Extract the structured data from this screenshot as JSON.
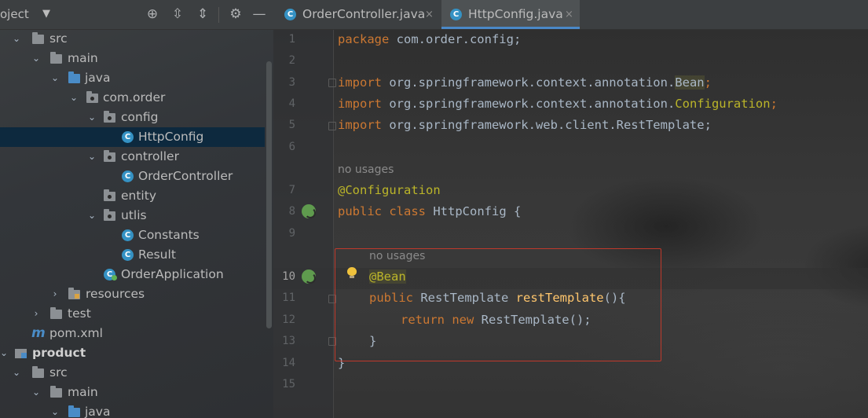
{
  "project_panel": {
    "title": "oject",
    "tree": [
      {
        "label": "src",
        "icon": "folder-icon"
      },
      {
        "label": "main",
        "icon": "folder-icon"
      },
      {
        "label": "java",
        "icon": "source-folder-icon"
      },
      {
        "label": "com.order",
        "icon": "package-icon"
      },
      {
        "label": "config",
        "icon": "package-icon"
      },
      {
        "label": "HttpConfig",
        "icon": "class-icon"
      },
      {
        "label": "controller",
        "icon": "package-icon"
      },
      {
        "label": "OrderController",
        "icon": "class-icon"
      },
      {
        "label": "entity",
        "icon": "package-icon"
      },
      {
        "label": "utlis",
        "icon": "package-icon"
      },
      {
        "label": "Constants",
        "icon": "class-icon"
      },
      {
        "label": "Result",
        "icon": "class-icon"
      },
      {
        "label": "OrderApplication",
        "icon": "spring-boot-class-icon"
      },
      {
        "label": "resources",
        "icon": "resources-folder-icon"
      },
      {
        "label": "test",
        "icon": "folder-icon"
      },
      {
        "label": "pom.xml",
        "icon": "maven-icon"
      },
      {
        "label": "product",
        "icon": "module-icon"
      },
      {
        "label": "src",
        "icon": "folder-icon"
      },
      {
        "label": "main",
        "icon": "folder-icon"
      },
      {
        "label": "java",
        "icon": "source-folder-icon"
      }
    ]
  },
  "tabs": [
    {
      "label": "OrderController.java",
      "close": "×"
    },
    {
      "label": "HttpConfig.java",
      "close": "×"
    }
  ],
  "class_glyph": "C",
  "maven_glyph": "m",
  "editor": {
    "line_numbers": [
      "1",
      "2",
      "3",
      "4",
      "5",
      "6",
      "7",
      "8",
      "9",
      "10",
      "11",
      "12",
      "13",
      "14",
      "15"
    ],
    "usages_hint": "no usages",
    "lines": {
      "l1_kw": "package",
      "l1_rest": " com.order.config;",
      "import_kw": "import",
      "l3_pkg": " org.springframework.context.annotation.",
      "l3_name": "Bean",
      "l4_pkg": " org.springframework.context.annotation.",
      "l4_name": "Configuration",
      "l5_rest": " org.springframework.web.client.RestTemplate;",
      "semicolon": ";",
      "l7_annotation": "@Configuration",
      "l8_kw1": "public",
      "l8_kw2": " class",
      "l8_rest": " HttpConfig {",
      "l10_annotation": "@Bean",
      "l11_kw": "public",
      "l11_type": " RestTemplate ",
      "l11_method": "restTemplate",
      "l11_rest": "(){",
      "l12_kw1": "return",
      "l12_kw2": " new",
      "l12_rest": " RestTemplate();",
      "l13": "}",
      "l14": "}"
    }
  },
  "colors": {
    "keyword": "#cc7832",
    "annotation": "#bbb529",
    "method": "#ffc66d",
    "highlight_box": "#c0392b",
    "accent": "#4a88c7"
  }
}
